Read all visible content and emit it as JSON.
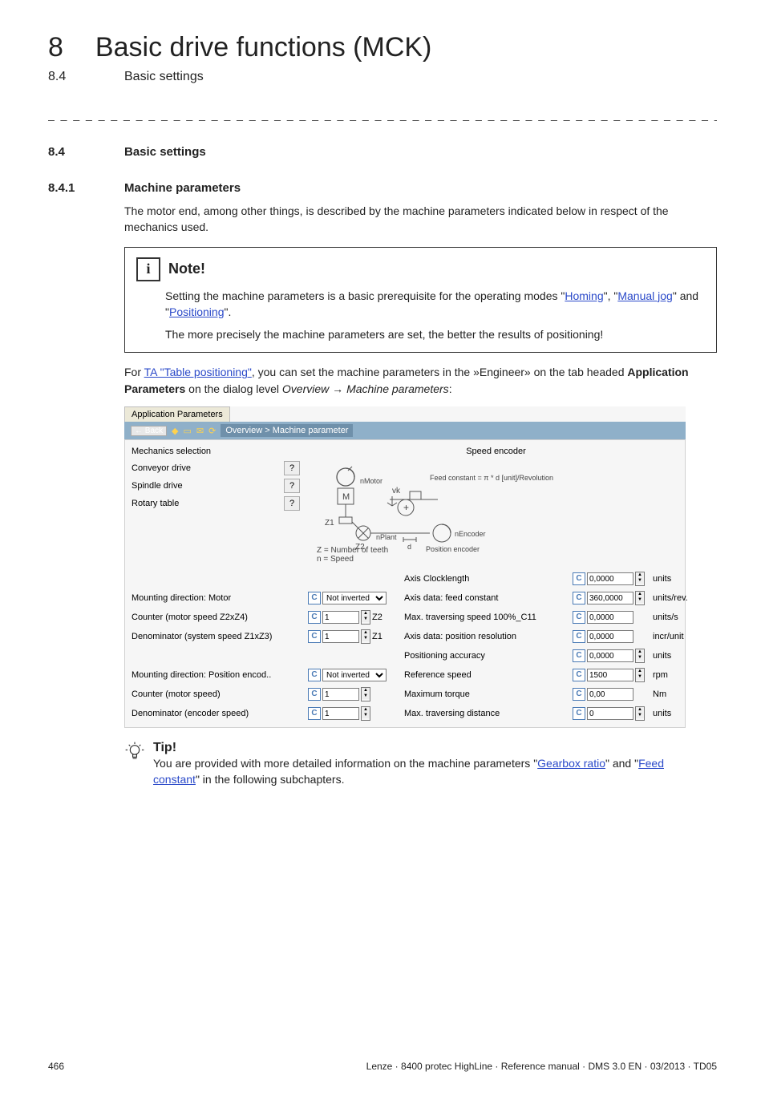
{
  "chapter": {
    "num": "8",
    "title": "Basic drive functions (MCK)"
  },
  "subline": {
    "num": "8.4",
    "title": "Basic settings"
  },
  "dashline": "_ _ _ _ _ _ _ _ _ _ _ _ _ _ _ _ _ _ _ _ _ _ _ _ _ _ _ _ _ _ _ _ _ _ _ _ _ _ _ _ _ _ _ _ _ _ _ _ _ _ _ _ _ _ _ _ _ _ _ _ _ _ _ _",
  "sec1": {
    "num": "8.4",
    "title": "Basic settings"
  },
  "sec2": {
    "num": "8.4.1",
    "title": "Machine parameters"
  },
  "para1": "The motor end, among other things, is described by the machine parameters indicated below in respect of the mechanics used.",
  "note": {
    "title": "Note!",
    "l1a": "Setting the machine parameters is a basic prerequisite for the operating modes \"",
    "homing": "Homing",
    "l1b": "\", \"",
    "manual": "Manual jog",
    "l1c": "\" and \"",
    "positioning": "Positioning",
    "l1d": "\".",
    "l2": "The more precisely the machine parameters are set, the better the results of positioning!"
  },
  "para2a": "For ",
  "para2link": "TA \"Table positioning\"",
  "para2b": ", you can set the machine parameters in the »Engineer» on the tab headed ",
  "para2bold": "Application Parameters",
  "para2c": " on the dialog level ",
  "para2it1": "Overview",
  "para2arrow": " → ",
  "para2it2": "Machine parameters",
  "para2d": ":",
  "app": {
    "tab": "Application Parameters",
    "back": "← Back",
    "crumb": "Overview > Machine parameter",
    "mech_title": "Mechanics selection",
    "mech1": "Conveyor drive",
    "mech2": "Spindle drive",
    "mech3": "Rotary table",
    "speed_title": "Speed encoder",
    "feed_formula": "Feed constant = π * d [unit]/Revolution",
    "z_legend": "Z = Number of teeth",
    "n_legend": "n = Speed",
    "n_motor": "nMotor",
    "n_plant": "nPlant",
    "n_encoder": "nEncoder",
    "pos_enc_label": "Position encoder",
    "vk": "vk",
    "z1": "Z1",
    "z2": "Z2",
    "m": "M",
    "d": "d",
    "rows_left": [
      {
        "label": "Mounting direction: Motor",
        "val": "Not inverted",
        "suf": ""
      },
      {
        "label": "Counter (motor speed Z2xZ4)",
        "val": "1",
        "suf": "Z2"
      },
      {
        "label": "Denominator (system speed Z1xZ3)",
        "val": "1",
        "suf": "Z1"
      },
      {
        "label": "Mounting direction: Position encod..",
        "val": "Not inverted",
        "suf": ""
      },
      {
        "label": "Counter (motor speed)",
        "val": "1",
        "suf": ""
      },
      {
        "label": "Denominator (encoder speed)",
        "val": "1",
        "suf": ""
      }
    ],
    "rows_right": [
      {
        "label": "Axis Clocklength",
        "val": "0,0000",
        "unit": "units"
      },
      {
        "label": "Axis data: feed constant",
        "val": "360,0000",
        "unit": "units/rev."
      },
      {
        "label": "Max. traversing speed 100%_C11",
        "val": "0,0000",
        "unit": "units/s"
      },
      {
        "label": "Axis data: position resolution",
        "val": "0,0000",
        "unit": "incr/unit"
      },
      {
        "label": "Positioning accuracy",
        "val": "0,0000",
        "unit": "units"
      },
      {
        "label": "Reference speed",
        "val": "1500",
        "unit": "rpm"
      },
      {
        "label": "Maximum torque",
        "val": "0,00",
        "unit": "Nm"
      },
      {
        "label": "Max. traversing distance",
        "val": "0",
        "unit": "units"
      }
    ]
  },
  "tip": {
    "title": "Tip!",
    "a": "You are provided with more detailed information on the machine parameters \"",
    "gear": "Gearbox ratio",
    "b": "\" and \"",
    "feed": "Feed constant",
    "c": "\" in the following subchapters."
  },
  "footer": {
    "page": "466",
    "ref": "Lenze · 8400 protec HighLine · Reference manual · DMS 3.0 EN · 03/2013 · TD05"
  }
}
